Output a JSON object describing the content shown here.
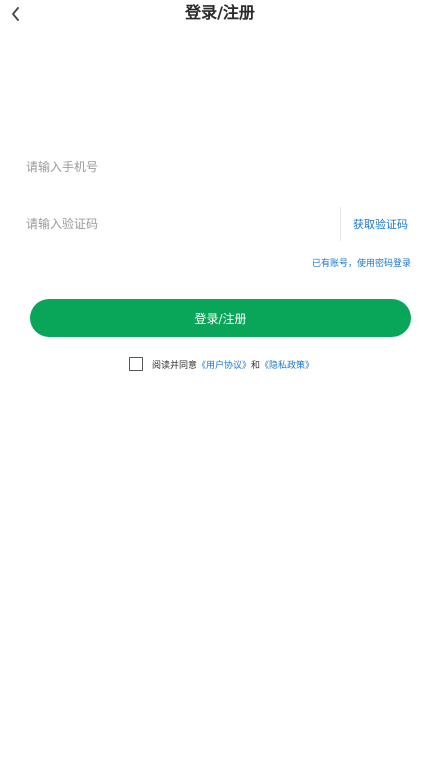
{
  "header": {
    "title": "登录/注册",
    "back_icon": "chevron-left-icon"
  },
  "phone_field": {
    "value": "",
    "placeholder": "请输入手机号"
  },
  "code_field": {
    "value": "",
    "placeholder": "请输入验证码",
    "get_code_label": "获取验证码"
  },
  "password_login_link": "已有账号，使用密码登录",
  "submit_label": "登录/注册",
  "agreement": {
    "checked": false,
    "prefix": "阅读并同意",
    "user_agreement": "《用户协议》",
    "conjunction": "和",
    "privacy_policy": "《隐私政策》"
  },
  "colors": {
    "primary": "#09a659",
    "link": "#1a76d2",
    "placeholder": "#9a9a9a"
  }
}
